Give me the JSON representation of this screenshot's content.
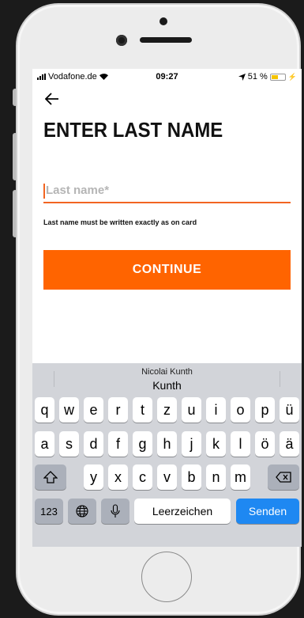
{
  "status_bar": {
    "carrier": "Vodafone.de",
    "time": "09:27",
    "battery_percent": "51 %",
    "battery_level": 0.51
  },
  "header": {
    "back_icon": "arrow-left-icon",
    "title": "ENTER LAST NAME"
  },
  "form": {
    "last_name_placeholder": "Last name*",
    "last_name_value": "",
    "hint": "Last name must be written exactly as on card",
    "continue_label": "CONTINUE"
  },
  "colors": {
    "accent": "#ff6400",
    "keyboard_bg": "#d2d4d9",
    "send_key": "#1e88f2"
  },
  "keyboard": {
    "suggestion_top": "Nicolai Kunth",
    "suggestion_main": "Kunth",
    "row1": [
      "q",
      "w",
      "e",
      "r",
      "t",
      "z",
      "u",
      "i",
      "o",
      "p",
      "ü"
    ],
    "row2": [
      "a",
      "s",
      "d",
      "f",
      "g",
      "h",
      "j",
      "k",
      "l",
      "ö",
      "ä"
    ],
    "row3": [
      "y",
      "x",
      "c",
      "v",
      "b",
      "n",
      "m"
    ],
    "numbers_label": "123",
    "space_label": "Leerzeichen",
    "send_label": "Senden"
  }
}
